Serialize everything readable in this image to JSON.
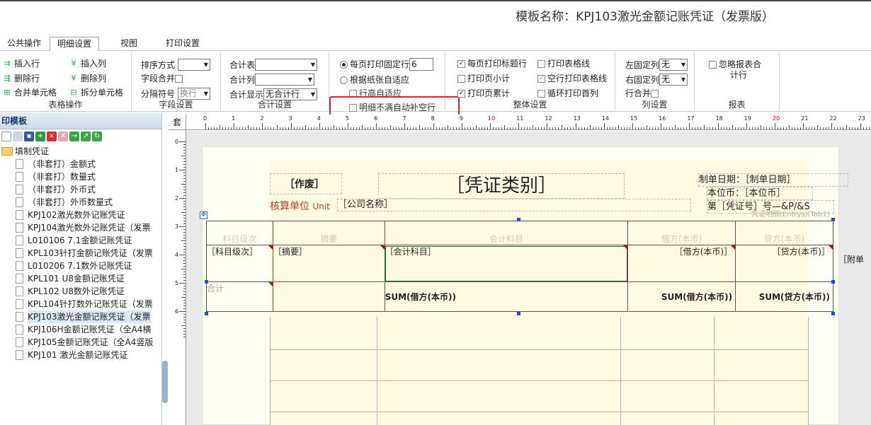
{
  "template_title": "模板名称：KPJ103激光金额记账凭证（发票版）",
  "tabs": [
    "公共操作",
    "明细设置",
    "视图",
    "打印设置"
  ],
  "toolbar": {
    "table_ops": {
      "insert_row": "插入行",
      "delete_row": "删除行",
      "merge_cells": "合并单元格",
      "insert_col": "插入列",
      "delete_col": "删除列",
      "split_cells": "拆分单元格",
      "label": "表格操作"
    },
    "field_settings": {
      "sort_label": "排序方式",
      "sort_value": "",
      "merge_label": "字段合并",
      "separator_label": "分隔符号",
      "separator_value": "换行",
      "label": "字段设置"
    },
    "total_settings": {
      "total_table_label": "合计表",
      "total_table_value": "",
      "total_col_label": "合计列",
      "total_col_value": "",
      "total_show_label": "合计显示",
      "total_show_value": "无合计行",
      "label": "合计设置"
    },
    "print_rows": {
      "fixed_label": "每页打印固定行",
      "fixed_value": "6",
      "adapt_label": "根据纸张自适应",
      "height_adapt_label": "行高自适应",
      "fill_label": "明细不满自动补空行"
    },
    "overall": {
      "print_title_rows": "每页打印标题行",
      "print_page_subtotal": "打印页小计",
      "print_page_cumulative": "打印页累计",
      "print_table_lines": "打印表格线",
      "empty_row_lines": "空行打印表格线",
      "loop_first_col": "循环打印首列",
      "label": "整体设置"
    },
    "col_settings": {
      "left_fixed_label": "左固定列",
      "left_fixed_value": "无",
      "right_fixed_label": "右固定列",
      "right_fixed_value": "无",
      "row_merge_label": "行合并",
      "label": "列设置"
    },
    "report": {
      "ignore_total_l1": "忽略报表合",
      "ignore_total_l2": "计行",
      "label": "报表"
    }
  },
  "sidebar": {
    "header": "印模板",
    "root": "填制凭证",
    "items": [
      "（非套打）金额式",
      "（非套打）数量式",
      "（非套打）外币式",
      "（非套打）外币数量式",
      "KPJ102激光数外记账凭证",
      "KPJ104激光数外记账凭证（发票",
      "L010106 7.1金额记账凭证",
      "KPL103针打金额记账凭证（发票",
      "L010206 7.1数外记账凭证",
      "KPL101 U8金额记账凭证",
      "KPL102 U8数外记账凭证",
      "KPL104针打数外记账凭证（发票",
      "KPJ103激光金额记账凭证（发票",
      "KPJ106H金额记账凭证（全A4横",
      "KPJ105金额记账凭证（全A4竖版",
      "KPJ101 激光金额记账凭证"
    ],
    "selected_index": 12
  },
  "ruler": {
    "corner": "套",
    "top_ticks": [
      "0",
      "1",
      "2",
      "3",
      "4",
      "5",
      "6",
      "7",
      "8",
      "9",
      "10",
      "11",
      "12",
      "13",
      "14",
      "15",
      "16",
      "17",
      "18",
      "19",
      "20",
      "21",
      "22",
      "23"
    ],
    "left_ticks": [
      "0",
      "1",
      "2",
      "3",
      "4",
      "5",
      "6"
    ]
  },
  "voucher": {
    "void_label": "［作废］",
    "type_label": "［凭证类别］",
    "unit_label": "核算单位",
    "unit_en": "Unit",
    "company_field": "［公司名称］",
    "date_line": "制单日期：［制单日期］",
    "currency_line": "本位币：［本位币］",
    "number_line": "第［凭证号］号—&P/&S",
    "detail_tag": "凭证明细(Entrys)(Tab1)",
    "headers": [
      "科目级次",
      "摘要",
      "会计科目",
      "借方(本币)",
      "贷方(本币)"
    ],
    "row1": [
      "［科目级次］",
      "［摘要］",
      "［会计科目］",
      "［借方(本币)］",
      "［贷方(本币)］"
    ],
    "attach": "［附单",
    "total_label": "合计",
    "sum_debit": "SUM(借方(本币))",
    "sum_debit2": "SUM(借方(本币))",
    "sum_credit": "SUM(贷方(本币))"
  },
  "colors": {
    "highlight": "#e0242a",
    "unit_label": "#c0392b"
  }
}
